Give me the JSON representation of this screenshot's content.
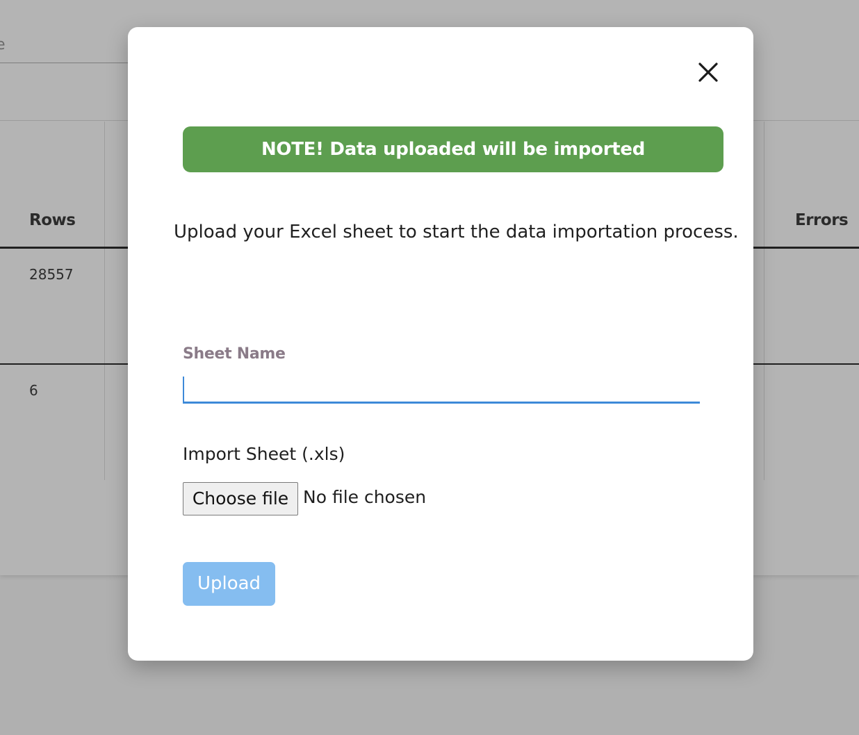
{
  "background": {
    "search_text_fragment": "e",
    "columns": {
      "rows_header": "Rows",
      "errors_header": "Errors"
    },
    "rows": [
      {
        "rows_value": "28557"
      },
      {
        "rows_value": "6"
      }
    ]
  },
  "modal": {
    "close_icon": "close-icon",
    "note": "NOTE! Data uploaded will be imported",
    "description": "Upload your Excel sheet to start the data importation process.",
    "sheet_name": {
      "label": "Sheet Name",
      "value": ""
    },
    "import": {
      "label": "Import Sheet (.xls)",
      "button_label": "Choose file",
      "status": "No file chosen"
    },
    "upload_label": "Upload"
  },
  "colors": {
    "note_bg": "#5d9e4f",
    "input_accent": "#3d89d8",
    "upload_bg": "#85bdf0",
    "overlay": "#afafaf"
  }
}
